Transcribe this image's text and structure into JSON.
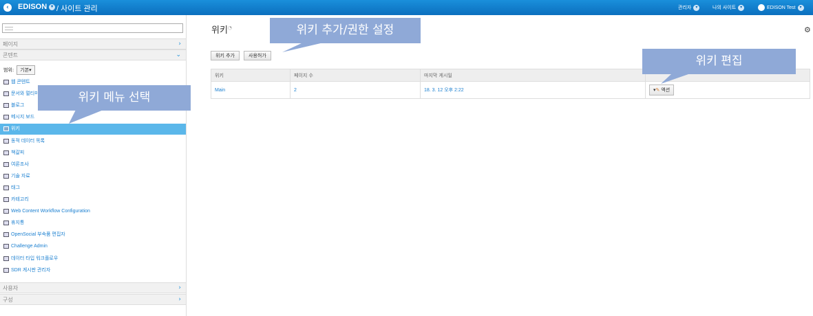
{
  "topbar": {
    "brand": "EDISON",
    "brand_caret": "▾",
    "title": "/ 사이트 관리",
    "admin_menu": "관리자",
    "my_sites_menu": "나의 사이트",
    "user_menu": "EDISON Test"
  },
  "sidebar": {
    "panels": {
      "pages": "페이지",
      "content": "콘텐트",
      "users": "사용자",
      "config": "구성"
    },
    "scope_label": "범위:",
    "scope_value": "기본",
    "items": [
      {
        "label": "웹 콘텐트",
        "icon": "web-content-icon"
      },
      {
        "label": "문서와 멀티미디어",
        "icon": "document-media-icon"
      },
      {
        "label": "블로그",
        "icon": "blog-icon"
      },
      {
        "label": "메시지 보드",
        "icon": "message-board-icon"
      },
      {
        "label": "위키",
        "icon": "wiki-icon"
      },
      {
        "label": "동적 데이터 목록",
        "icon": "dynamic-data-list-icon"
      },
      {
        "label": "책갈피",
        "icon": "bookmark-icon"
      },
      {
        "label": "여론조사",
        "icon": "poll-icon"
      },
      {
        "label": "기술 자료",
        "icon": "knowledge-base-icon"
      },
      {
        "label": "태그",
        "icon": "tag-icon"
      },
      {
        "label": "카테고리",
        "icon": "category-icon"
      },
      {
        "label": "Web Content Workflow Configuration",
        "icon": "workflow-icon"
      },
      {
        "label": "휴지통",
        "icon": "trash-icon"
      },
      {
        "label": "OpenSocial 부속품 편집자",
        "icon": "opensocial-icon"
      },
      {
        "label": "Challenge Admin",
        "icon": "challenge-icon"
      },
      {
        "label": "데이터 타입 워크플로우",
        "icon": "data-type-workflow-icon"
      },
      {
        "label": "SDR 게시판 관리자",
        "icon": "sdr-board-icon"
      }
    ]
  },
  "main": {
    "title": "위키",
    "add_wiki_button": "위키 추가",
    "permissions_button": "사용허가",
    "table": {
      "headers": [
        "위키",
        "페이지 수",
        "마지막 게시일",
        ""
      ],
      "rows": [
        {
          "name": "Main",
          "pages": "2",
          "last_post": "18. 3. 12 오후 2:22",
          "action": "액션"
        }
      ]
    }
  },
  "annotations": {
    "wiki_menu_select": "위키 메뉴 선택",
    "wiki_add_permission": "위키 추가/권한 설정",
    "wiki_edit": "위키 편집"
  }
}
